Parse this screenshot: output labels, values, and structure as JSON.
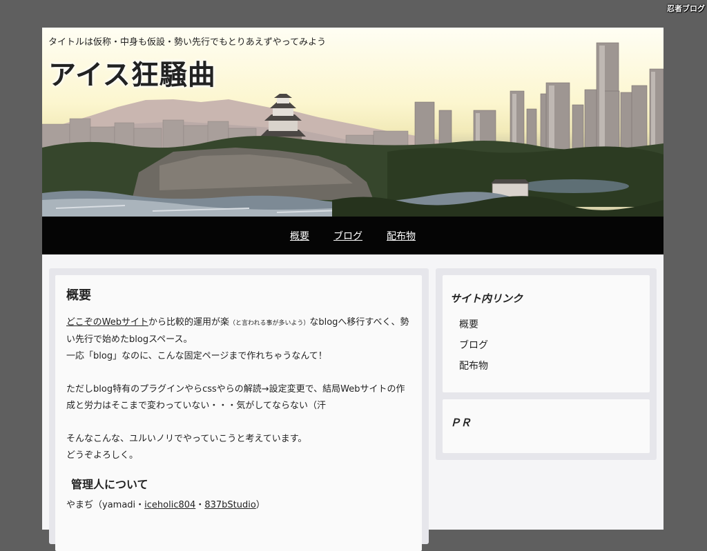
{
  "badge": {
    "label": "忍者ブログ"
  },
  "header": {
    "tagline": "タイトルは仮称・中身も仮設・勢い先行でもとりあえずやってみよう",
    "site_title": "アイス狂騒曲"
  },
  "nav": {
    "items": [
      {
        "label": "概要"
      },
      {
        "label": "ブログ"
      },
      {
        "label": "配布物"
      }
    ]
  },
  "article": {
    "heading": "概要",
    "p1": {
      "link": "どこぞのWebサイト",
      "text_a": "から比較的運用が楽",
      "small": "（と言われる事が多いよう）",
      "text_b": "なblogへ移行すべく、勢い先行で始めたblogスペース。"
    },
    "p1_line2": "一応「blog」なのに、こんな固定ページまで作れちゃうなんて！",
    "p2": "ただしblog特有のプラグインやらcssやらの解読→設定変更で、結局Webサイトの作成と労力はそこまで変わっていない・・・気がしてならない（汗",
    "p3_line1": "そんなこんな、ユルいノリでやっていこうと考えています。",
    "p3_line2": "どうぞよろしく。",
    "admin_heading": "管理人について",
    "admin": {
      "name": "やまぢ（yamadi・",
      "link1": "iceholic804",
      "sep": "・",
      "link2": "837bStudio",
      "end": "）"
    }
  },
  "sidebar": {
    "links_title": "サイト内リンク",
    "links": [
      {
        "label": "概要"
      },
      {
        "label": "ブログ"
      },
      {
        "label": "配布物"
      }
    ],
    "pr_title": "ＰＲ"
  },
  "colors": {
    "outer_bg": "#5f5f5f",
    "nav_bg": "#050505",
    "panel_bg": "#e6e6eb",
    "card_bg": "#fafafa"
  }
}
